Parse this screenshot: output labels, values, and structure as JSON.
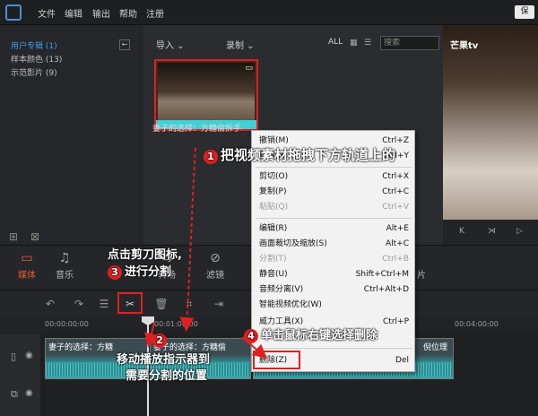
{
  "menubar": {
    "items": [
      "文件",
      "编辑",
      "输出",
      "帮助",
      "注册"
    ],
    "save_label": "保"
  },
  "library": {
    "items": [
      {
        "label": "用户专辑 (1)",
        "active": true
      },
      {
        "label": "样本颜色 (13)",
        "active": false
      },
      {
        "label": "示范影片 (9)",
        "active": false
      }
    ],
    "back_icon": "arrow-left-icon"
  },
  "media": {
    "import_label": "导入",
    "record_label": "录制",
    "filter_label": "ALL",
    "search_placeholder": "搜索",
    "clip_caption": "妻子的选择：方糖偷拆手"
  },
  "preview": {
    "brand": "芒果tv"
  },
  "tabs": [
    {
      "label": "媒体",
      "icon": "folder-icon",
      "active": true
    },
    {
      "label": "音乐",
      "icon": "music-icon",
      "active": false
    },
    {
      "label": "转场",
      "icon": "transition-icon",
      "active": false
    },
    {
      "label": "滤镜",
      "icon": "filter-icon",
      "active": false
    },
    {
      "label": "片",
      "icon": "element-icon",
      "active": false
    }
  ],
  "ruler": {
    "ticks": [
      "00:00:00:00",
      "00:01:00:00",
      "00:04:00:00"
    ]
  },
  "track": {
    "clips": [
      "妻子的选择：方糖",
      "妻子的选择：方糖偷",
      "倪位理"
    ]
  },
  "context_menu": {
    "items": [
      {
        "label": "撤销(M)",
        "shortcut": "Ctrl+Z",
        "disabled": false
      },
      {
        "label": "重做(R)",
        "shortcut": "Ctrl+Y",
        "disabled": false
      },
      {
        "label": "剪切(O)",
        "shortcut": "Ctrl+X",
        "disabled": false
      },
      {
        "label": "复制(P)",
        "shortcut": "Ctrl+C",
        "disabled": false
      },
      {
        "label": "粘贴(Q)",
        "shortcut": "Ctrl+V",
        "disabled": true
      },
      {
        "label": "编辑(R)",
        "shortcut": "Alt+E",
        "disabled": false
      },
      {
        "label": "画面裁切及缩放(S)",
        "shortcut": "Alt+C",
        "disabled": false
      },
      {
        "label": "分割(T)",
        "shortcut": "Ctrl+B",
        "disabled": true
      },
      {
        "label": "静音(U)",
        "shortcut": "Shift+Ctrl+M",
        "disabled": false
      },
      {
        "label": "音频分离(V)",
        "shortcut": "Ctrl+Alt+D",
        "disabled": false
      },
      {
        "label": "智能视频优化(W)",
        "shortcut": "",
        "disabled": false
      },
      {
        "label": "威力工具(X)",
        "shortcut": "Ctrl+P",
        "disabled": false
      },
      {
        "label": "删除(Z)",
        "shortcut": "Del",
        "disabled": false
      }
    ]
  },
  "annotations": {
    "a1": {
      "num": "1",
      "text": "把视频素材拖拽下方轨道上的"
    },
    "a2": {
      "num": "2",
      "text1": "移动播放指示器到",
      "text2": "需要分割的位置"
    },
    "a3": {
      "num": "3",
      "text1": "点击剪刀图标,",
      "text2": "进行分割"
    },
    "a4": {
      "num": "4",
      "text": "单击鼠标右键选择删除"
    }
  },
  "colors": {
    "accent": "#e02020",
    "active_tab": "#e95b2e",
    "link": "#3da0ea",
    "clip": "#41d0d5"
  }
}
